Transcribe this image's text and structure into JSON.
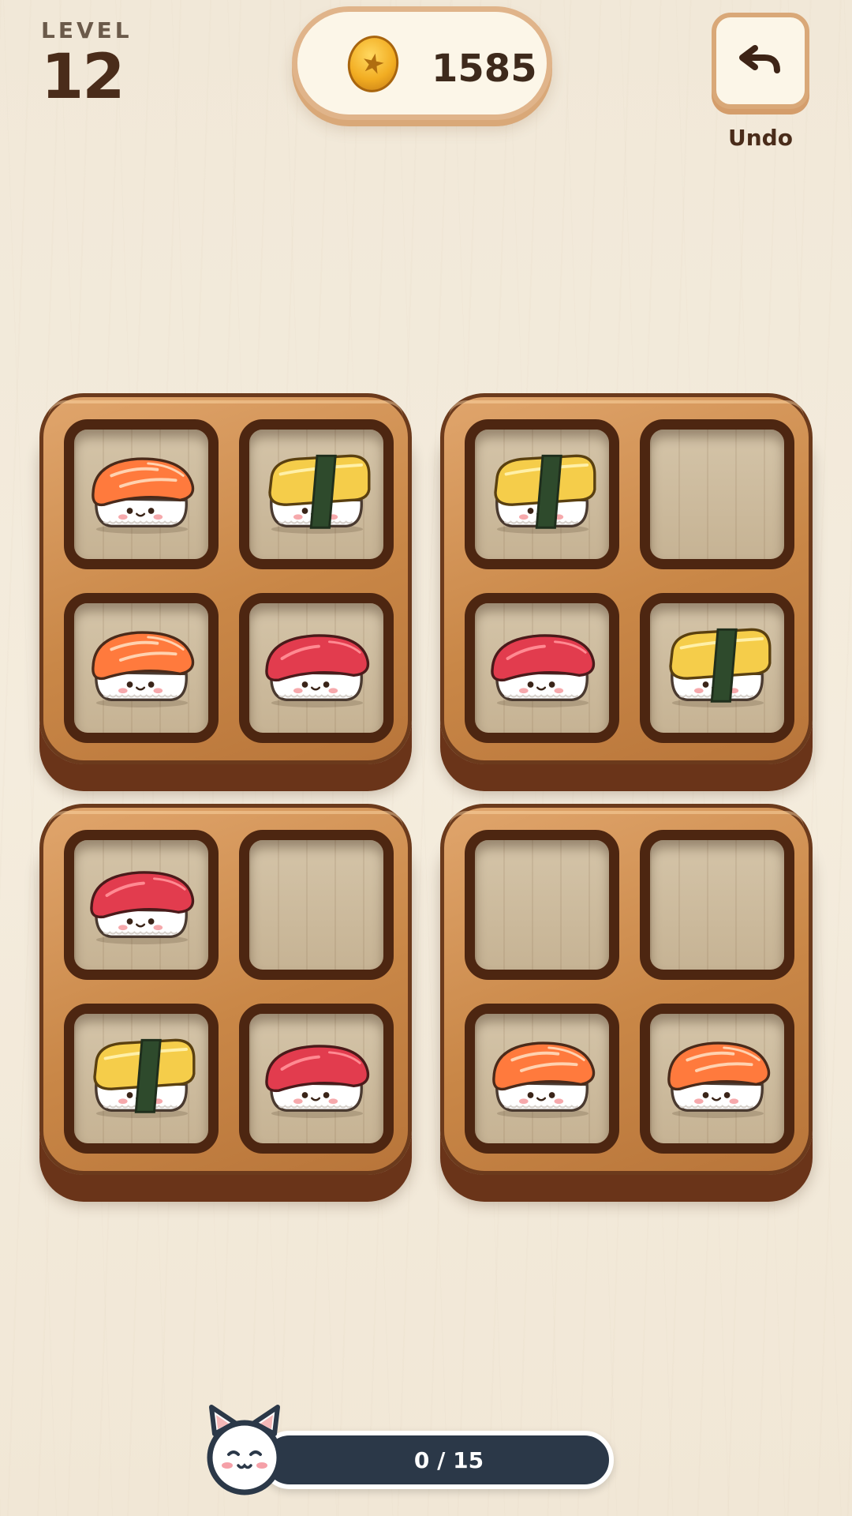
{
  "hud": {
    "level_label": "LEVEL",
    "level_number": "12",
    "coins": "1585",
    "undo_label": "Undo",
    "undo_icon": "undo-arrow-icon",
    "coin_icon": "gold-star-coin-icon"
  },
  "trays": [
    {
      "slots": [
        "salmon",
        "tamago",
        "salmon",
        "tuna"
      ]
    },
    {
      "slots": [
        "tamago",
        "empty",
        "tuna",
        "tamago"
      ]
    },
    {
      "slots": [
        "tuna",
        "empty",
        "tamago",
        "tuna"
      ]
    },
    {
      "slots": [
        "empty",
        "empty",
        "salmon",
        "salmon"
      ]
    }
  ],
  "progress": {
    "text": "0 / 15",
    "current": 0,
    "total": 15,
    "mascot_icon": "cat-mascot-icon"
  },
  "colors": {
    "salmon": "#ff7a3d",
    "tuna": "#e23c4e",
    "tamago": "#f5cd4a",
    "nori": "#2e4a2c",
    "tray_wood": "#c98747",
    "progress_bar": "#2b3848"
  }
}
